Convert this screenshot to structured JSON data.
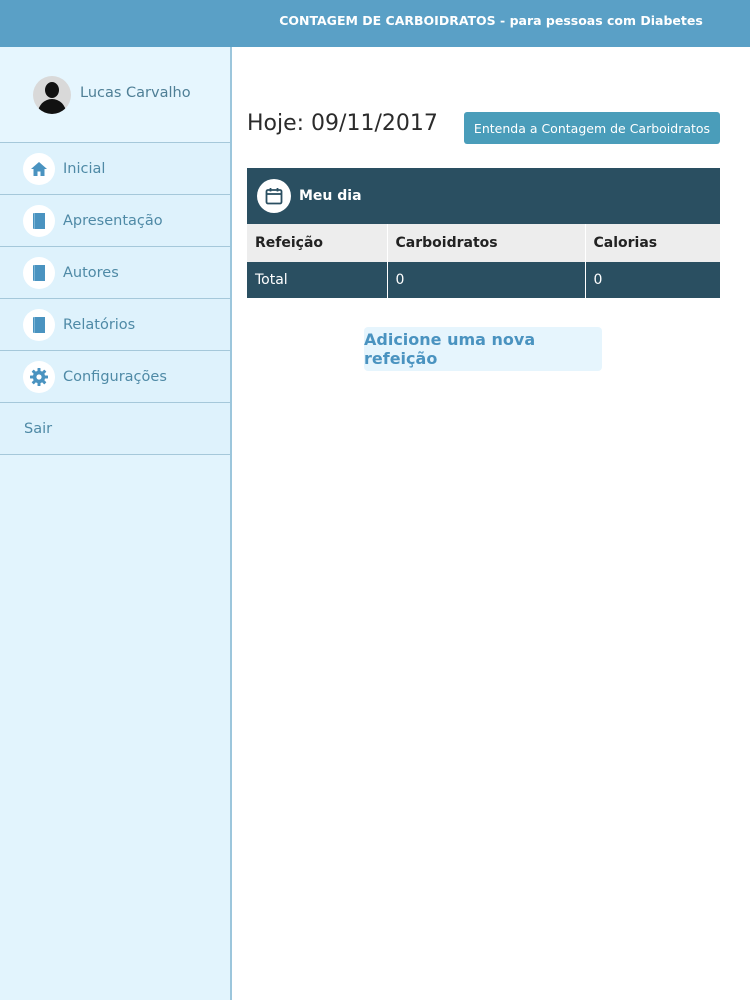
{
  "app": {
    "title": "CONTAGEM DE CARBOIDRATOS - para pessoas com Diabetes"
  },
  "user": {
    "name": "Lucas Carvalho"
  },
  "sidebar": {
    "items": [
      {
        "label": "Inicial",
        "icon": "home-icon"
      },
      {
        "label": "Apresentação",
        "icon": "document-icon"
      },
      {
        "label": "Autores",
        "icon": "document-icon"
      },
      {
        "label": "Relatórios",
        "icon": "document-icon"
      },
      {
        "label": "Configurações",
        "icon": "gear-icon"
      },
      {
        "label": "Sair"
      }
    ]
  },
  "main": {
    "date": "Hoje: 09/11/2017",
    "explain_button": "Entenda a Contagem de Carboidratos",
    "panel_title": "Meu dia",
    "table": {
      "headers": [
        "Refeição",
        "Carboidratos",
        "Calorias"
      ],
      "rows": [
        [
          "Total",
          "0",
          "0"
        ]
      ]
    },
    "add_button": "Adicione uma nova refeição"
  },
  "colors": {
    "header": "#5aa0c6",
    "sidebar_bg": "#e2f4fd",
    "panel_dark": "#2a4f61",
    "accent_button": "#4a9dba",
    "link_blue": "#4a93c0"
  }
}
